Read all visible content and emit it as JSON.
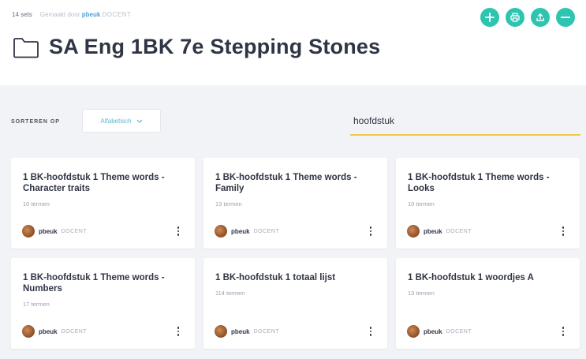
{
  "header": {
    "sets_count": "14 sets",
    "made_by_prefix": "Gemaakt door",
    "made_by_user": "pbeuk",
    "made_by_role": "DOCENT",
    "title": "SA Eng 1BK 7e Stepping Stones",
    "actions": [
      {
        "icon": "plus-icon"
      },
      {
        "icon": "print-icon"
      },
      {
        "icon": "upload-icon"
      },
      {
        "icon": "minus-icon"
      }
    ]
  },
  "toolbar": {
    "sort_label": "SORTEREN OP",
    "sort_value": "Alfabetisch",
    "search_value": "hoofdstuk"
  },
  "cards": [
    {
      "title": "1 BK-hoofdstuk 1 Theme words - Character traits",
      "terms": "10 termen",
      "author": "pbeuk",
      "role": "DOCENT"
    },
    {
      "title": "1 BK-hoofdstuk 1 Theme words - Family",
      "terms": "13 termen",
      "author": "pbeuk",
      "role": "DOCENT"
    },
    {
      "title": "1 BK-hoofdstuk 1 Theme words - Looks",
      "terms": "10 termen",
      "author": "pbeuk",
      "role": "DOCENT"
    },
    {
      "title": "1 BK-hoofdstuk 1 Theme words - Numbers",
      "terms": "17 termen",
      "author": "pbeuk",
      "role": "DOCENT"
    },
    {
      "title": "1 BK-hoofdstuk 1 totaal lijst",
      "terms": "114 termen",
      "author": "pbeuk",
      "role": "DOCENT"
    },
    {
      "title": "1 BK-hoofdstuk 1 woordjes A",
      "terms": "13 termen",
      "author": "pbeuk",
      "role": "DOCENT"
    }
  ],
  "colors": {
    "accent": "#2ec5b0",
    "search_underline": "#f2c94c",
    "background": "#f1f3f6",
    "text": "#303545"
  }
}
